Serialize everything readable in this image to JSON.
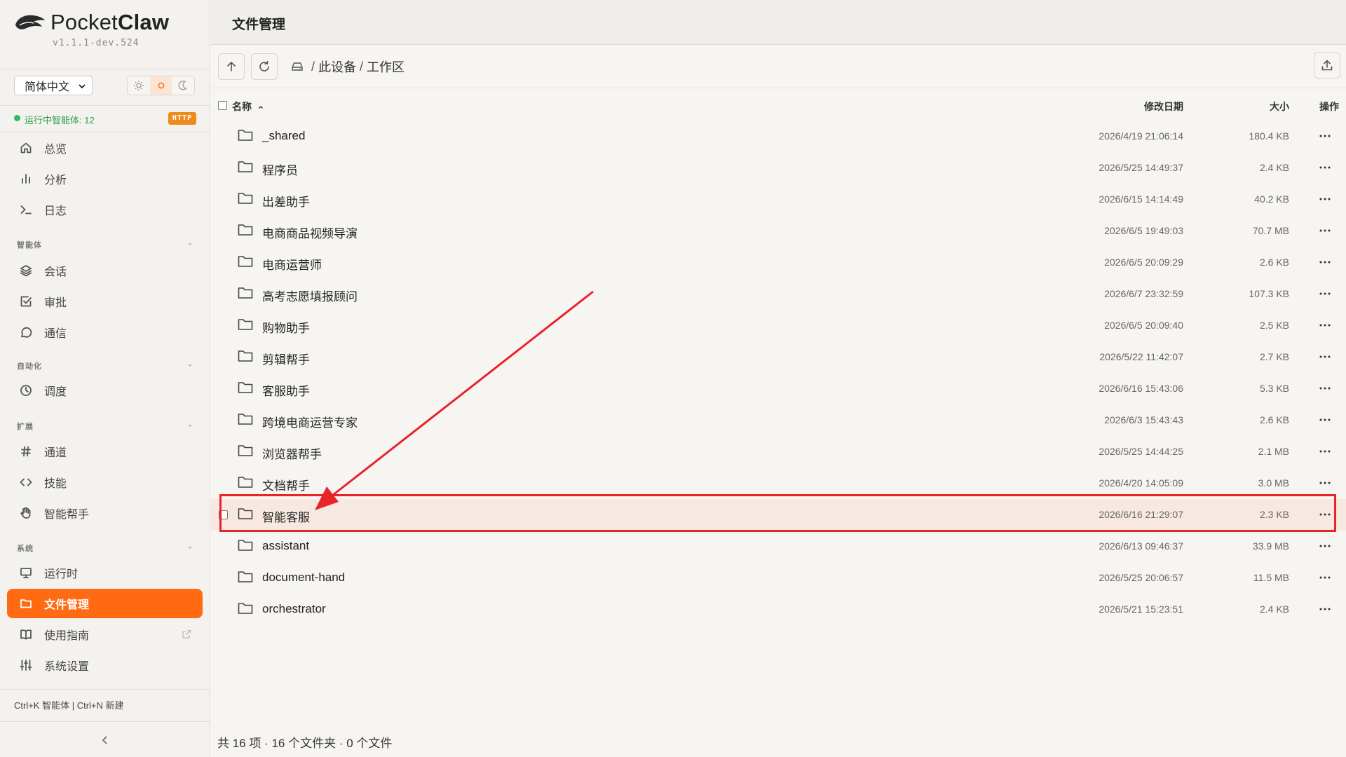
{
  "app": {
    "name_light": "Pocket",
    "name_bold": "Claw",
    "version": "v1.1.1-dev.524"
  },
  "controls": {
    "language": "简体中文",
    "theme_options": [
      "sun-icon",
      "circle-icon",
      "moon-icon"
    ],
    "theme_active_index": 1
  },
  "status": {
    "text": "运行中智能体: 12",
    "badge": "HTTP"
  },
  "nav": {
    "primary": [
      {
        "label": "总览",
        "icon": "home-icon"
      },
      {
        "label": "分析",
        "icon": "bar-chart-icon"
      },
      {
        "label": "日志",
        "icon": "terminal-icon"
      }
    ],
    "sections": [
      {
        "title": "智能体",
        "items": [
          {
            "label": "会话",
            "icon": "layers-icon"
          },
          {
            "label": "审批",
            "icon": "check-square-icon"
          },
          {
            "label": "通信",
            "icon": "message-circle-icon"
          }
        ]
      },
      {
        "title": "自动化",
        "items": [
          {
            "label": "调度",
            "icon": "clock-icon"
          }
        ]
      },
      {
        "title": "扩展",
        "items": [
          {
            "label": "通道",
            "icon": "hash-icon"
          },
          {
            "label": "技能",
            "icon": "code-icon"
          },
          {
            "label": "智能帮手",
            "icon": "hand-icon"
          }
        ]
      },
      {
        "title": "系统",
        "items": [
          {
            "label": "运行时",
            "icon": "monitor-icon"
          },
          {
            "label": "文件管理",
            "icon": "folder-icon",
            "active": true
          },
          {
            "label": "使用指南",
            "icon": "book-icon",
            "external": true
          },
          {
            "label": "系统设置",
            "icon": "sliders-icon"
          }
        ]
      }
    ]
  },
  "shortcut_hint": "Ctrl+K 智能体 | Ctrl+N 新建",
  "page": {
    "title": "文件管理"
  },
  "breadcrumb": [
    "此设备",
    "工作区"
  ],
  "columns": {
    "name": "名称",
    "modified": "修改日期",
    "size": "大小",
    "actions": "操作"
  },
  "files": [
    {
      "name": "_shared",
      "modified": "2026/4/19 21:06:14",
      "size": "180.4 KB"
    },
    {
      "name": "程序员",
      "modified": "2026/5/25 14:49:37",
      "size": "2.4 KB"
    },
    {
      "name": "出差助手",
      "modified": "2026/6/15 14:14:49",
      "size": "40.2 KB"
    },
    {
      "name": "电商商品视频导演",
      "modified": "2026/6/5 19:49:03",
      "size": "70.7 MB"
    },
    {
      "name": "电商运营师",
      "modified": "2026/6/5 20:09:29",
      "size": "2.6 KB"
    },
    {
      "name": "高考志愿填报顾问",
      "modified": "2026/6/7 23:32:59",
      "size": "107.3 KB"
    },
    {
      "name": "购物助手",
      "modified": "2026/6/5 20:09:40",
      "size": "2.5 KB"
    },
    {
      "name": "剪辑帮手",
      "modified": "2026/5/22 11:42:07",
      "size": "2.7 KB"
    },
    {
      "name": "客服助手",
      "modified": "2026/6/16 15:43:06",
      "size": "5.3 KB"
    },
    {
      "name": "跨境电商运营专家",
      "modified": "2026/6/3 15:43:43",
      "size": "2.6 KB"
    },
    {
      "name": "浏览器帮手",
      "modified": "2026/5/25 14:44:25",
      "size": "2.1 MB"
    },
    {
      "name": "文档帮手",
      "modified": "2026/4/20 14:05:09",
      "size": "3.0 MB"
    },
    {
      "name": "智能客服",
      "modified": "2026/6/16 21:29:07",
      "size": "2.3 KB",
      "selected": true
    },
    {
      "name": "assistant",
      "modified": "2026/6/13 09:46:37",
      "size": "33.9 MB"
    },
    {
      "name": "document-hand",
      "modified": "2026/5/25 20:06:57",
      "size": "11.5 MB"
    },
    {
      "name": "orchestrator",
      "modified": "2026/5/21 15:23:51",
      "size": "2.4 KB"
    }
  ],
  "footer": {
    "summary": "共 16 项 · 16 个文件夹 · 0 个文件"
  },
  "colors": {
    "accent": "#ff6a13",
    "status_green": "#2ebd5a",
    "badge_orange": "#ef8a1c",
    "annotation_red": "#e8232a",
    "selected_row": "#f7e9e1"
  }
}
